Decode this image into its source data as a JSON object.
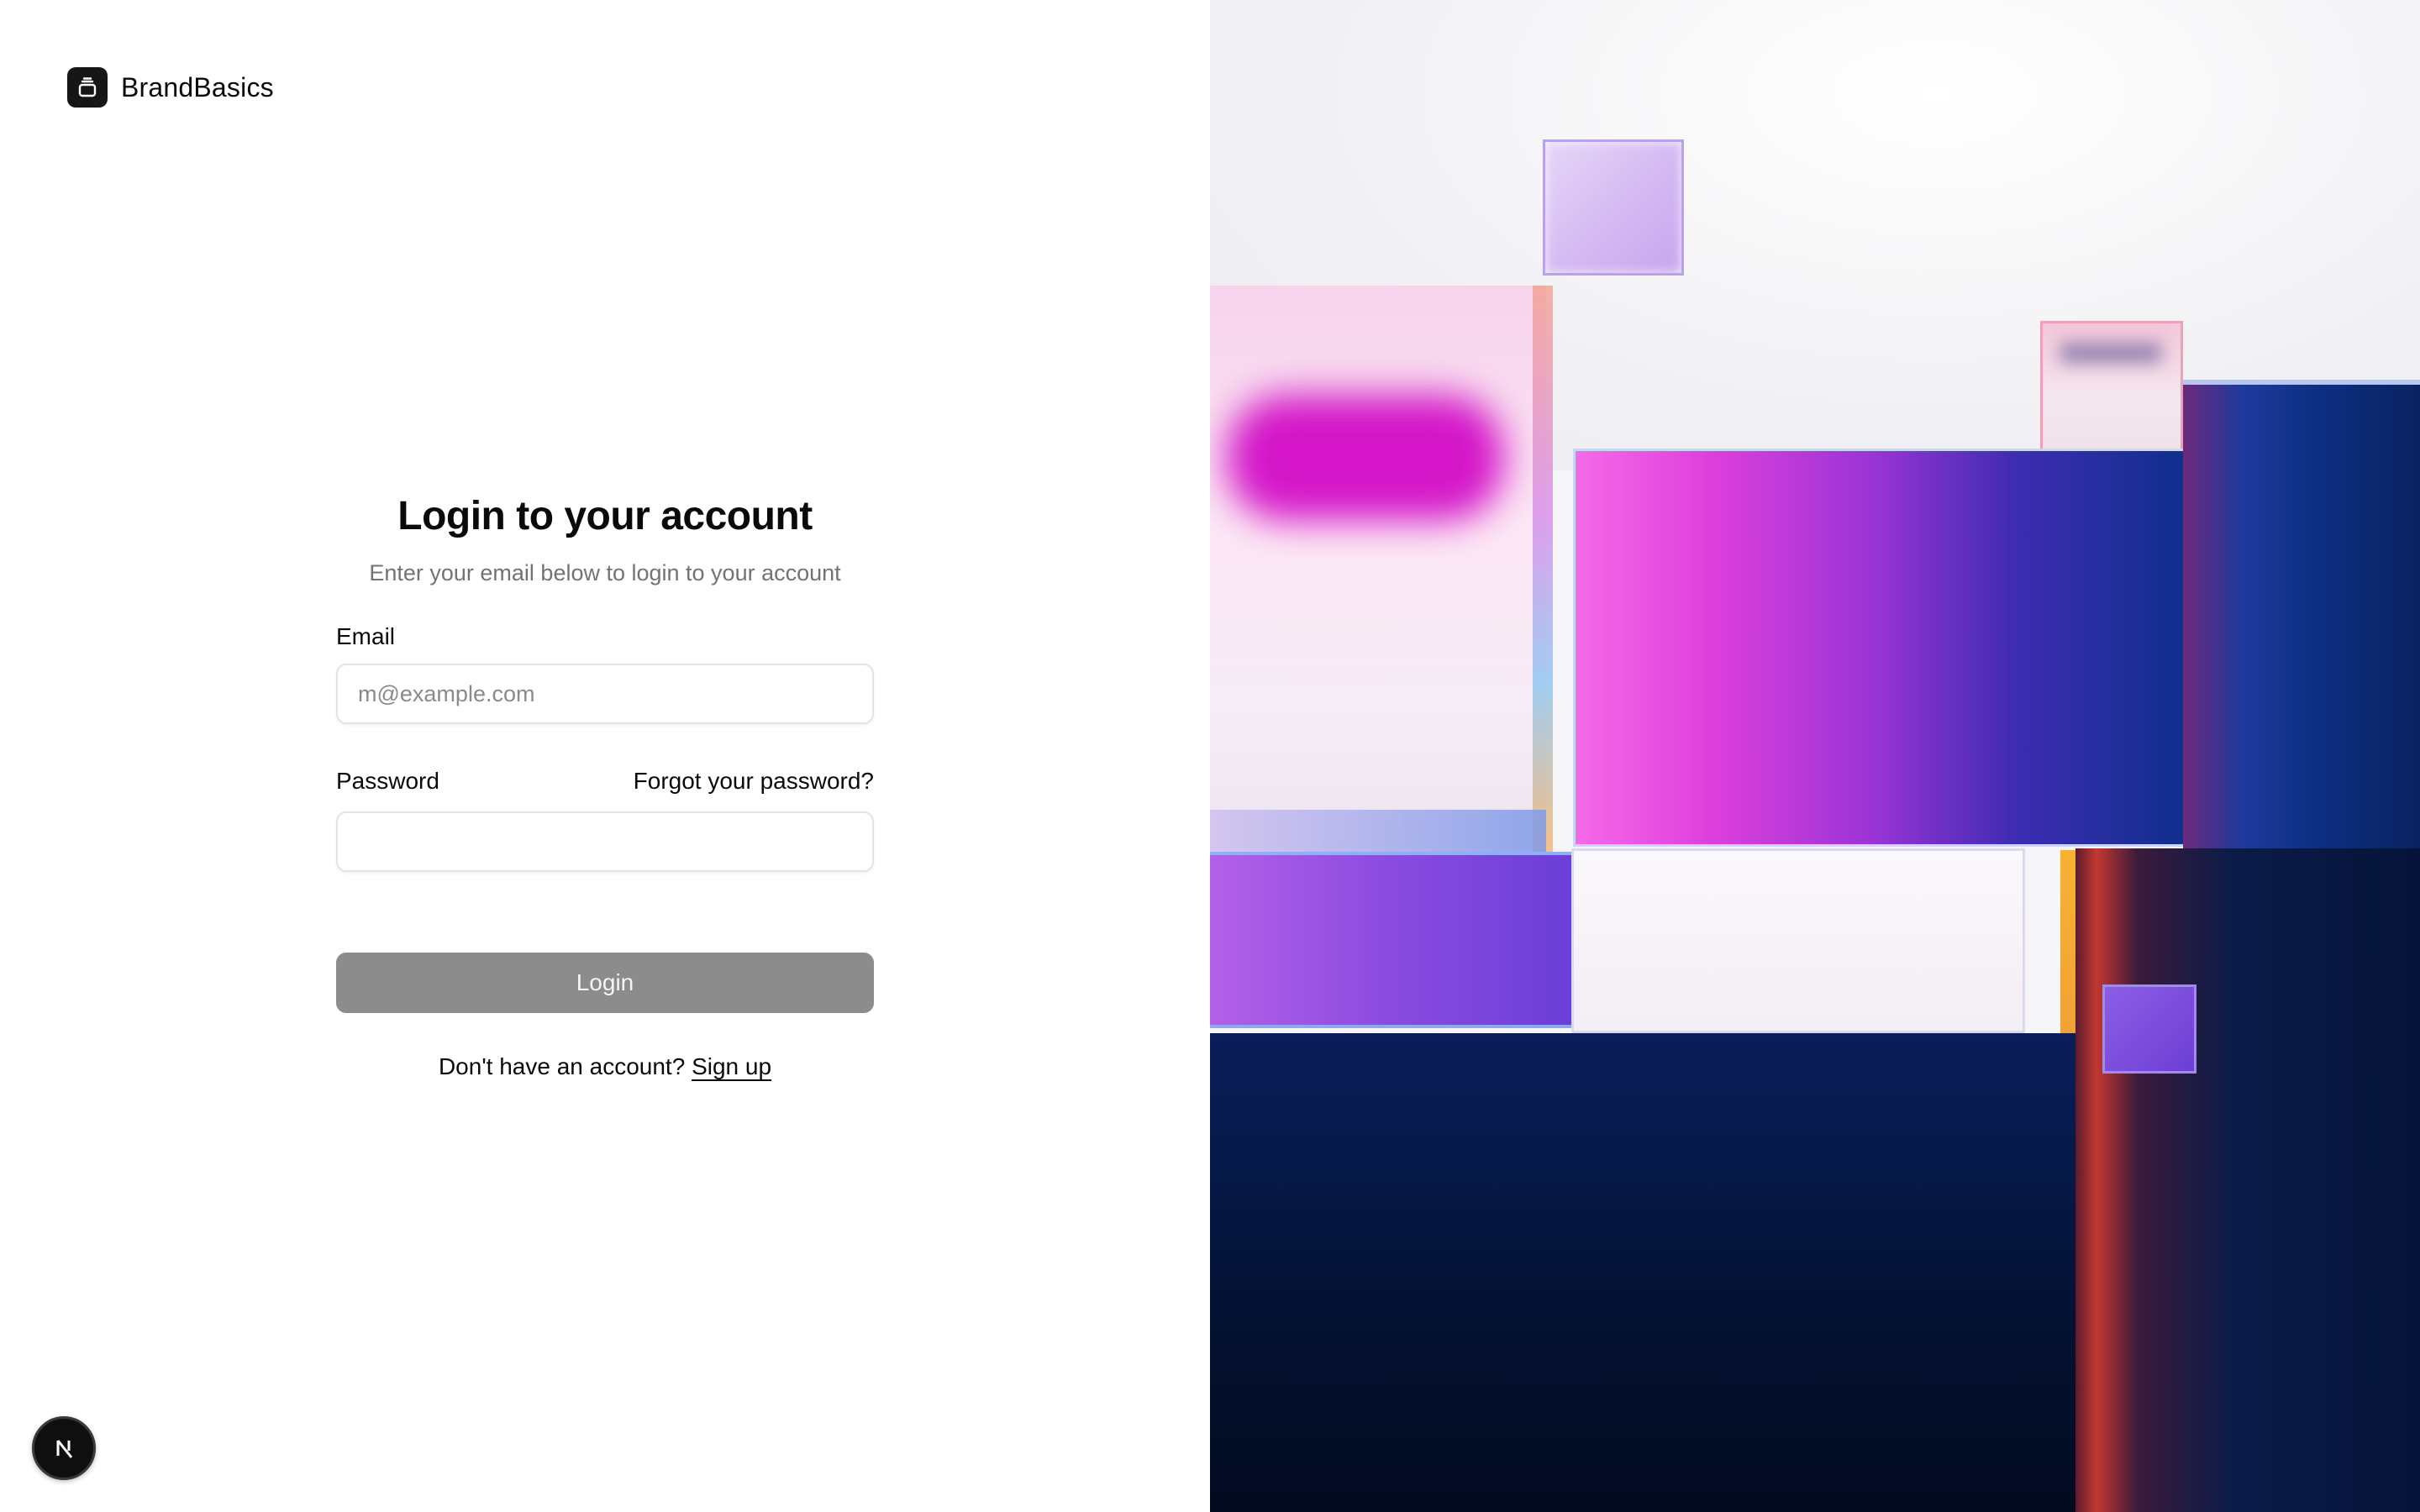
{
  "brand": {
    "name": "BrandBasics",
    "icon": "stacked-box-icon"
  },
  "login": {
    "title": "Login to your account",
    "subtitle": "Enter your email below to login to your account",
    "email_label": "Email",
    "email_placeholder": "m@example.com",
    "email_value": "",
    "password_label": "Password",
    "forgot_label": "Forgot your password?",
    "password_value": "",
    "submit_label": "Login",
    "signup_prompt": "Don't have an account?",
    "signup_label": "Sign up"
  },
  "badge": {
    "letter": "N",
    "icon": "nextjs-icon"
  },
  "colors": {
    "button_bg": "#8c8c8d",
    "magenta": "#e040d8",
    "navy": "#0b1a5c",
    "violet": "#7b3fe0"
  }
}
